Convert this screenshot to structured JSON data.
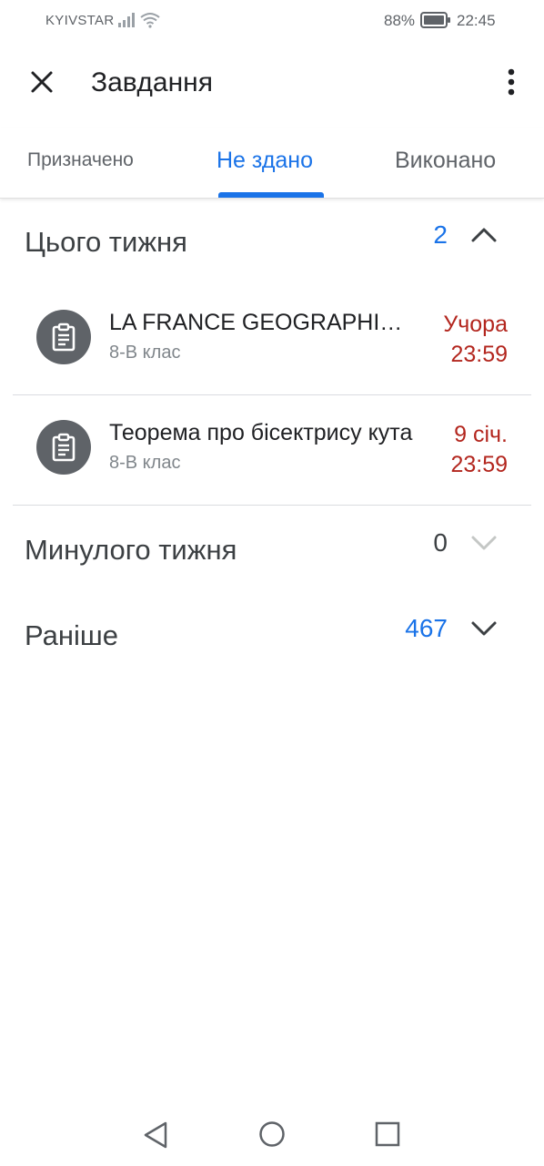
{
  "status_bar": {
    "carrier": "KYIVSTAR",
    "battery": "88%",
    "time": "22:45"
  },
  "app_bar": {
    "title": "Завдання",
    "close_icon": "close-icon",
    "more_icon": "more-vert-icon"
  },
  "tabs": [
    {
      "label": "Призначено",
      "active": false
    },
    {
      "label": "Не здано",
      "active": true
    },
    {
      "label": "Виконано",
      "active": false
    }
  ],
  "colors": {
    "accent": "#1a73e8",
    "due": "#b3261e",
    "icon_bg": "#5f6368"
  },
  "sections": {
    "this_week": {
      "title": "Цього тижня",
      "count": "2",
      "expanded": true,
      "items": [
        {
          "title": "LA FRANCE GEOGRAPHIQUE",
          "class": "8-В клас",
          "due_date": "Учора",
          "due_time": "23:59"
        },
        {
          "title": "Теорема про бісектрису кута",
          "class": "8-В клас",
          "due_date": "9 січ.",
          "due_time": "23:59"
        }
      ]
    },
    "last_week": {
      "title": "Минулого тижня",
      "count": "0",
      "expanded": false
    },
    "earlier": {
      "title": "Раніше",
      "count": "467",
      "expanded": false
    }
  },
  "nav": {
    "back_icon": "back-triangle-icon",
    "home_icon": "home-circle-icon",
    "recent_icon": "recents-square-icon"
  }
}
